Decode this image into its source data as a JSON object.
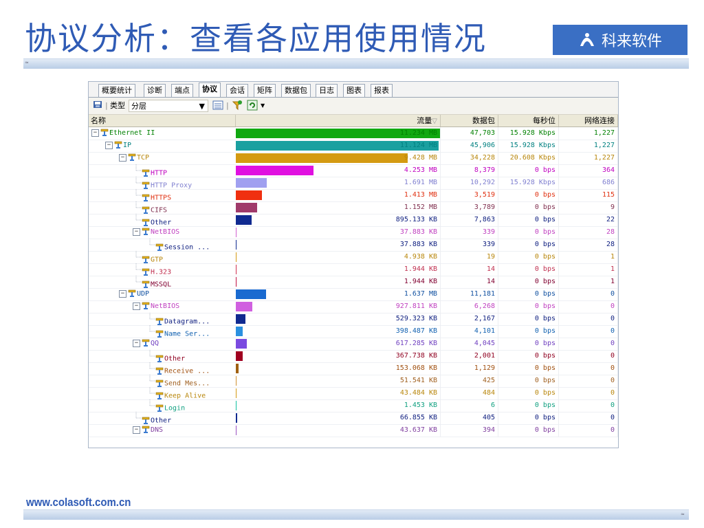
{
  "slide": {
    "title": "协议分析：查看各应用使用情况",
    "logo_text": "科来软件",
    "footer_url": "www.colasoft.com.cn",
    "corner_mark": "≈"
  },
  "tabs": [
    "概要统计",
    "诊断",
    "端点",
    "协议",
    "会话",
    "矩阵",
    "数据包",
    "日志",
    "图表",
    "报表"
  ],
  "active_tab": "协议",
  "toolbar": {
    "type_label": "类型",
    "type_value": "分层"
  },
  "columns": {
    "name": "名称",
    "traffic": "流量",
    "packets": "数据包",
    "bps": "每秒位",
    "connections": "网络连接"
  },
  "rows": [
    {
      "name": "Ethernet II",
      "level": 0,
      "expander": "−",
      "color": "#008000",
      "traffic": "11.234 MB",
      "packets": "47,703",
      "bps": "15.928 Kbps",
      "conn": "1,227",
      "fill": 1.0,
      "bar": "#11a811"
    },
    {
      "name": "IP",
      "level": 1,
      "expander": "−",
      "color": "#008080",
      "traffic": "11.124 MB",
      "packets": "45,906",
      "bps": "15.928 Kbps",
      "conn": "1,227",
      "fill": 0.99,
      "bar": "#1aa0a0"
    },
    {
      "name": "TCP",
      "level": 2,
      "expander": "−",
      "color": "#b8860b",
      "traffic": "9.428 MB",
      "packets": "34,228",
      "bps": "20.608 Kbps",
      "conn": "1,227",
      "fill": 0.84,
      "bar": "#d49a12"
    },
    {
      "name": "HTTP",
      "level": 3,
      "expander": "",
      "color": "#c000c0",
      "traffic": "4.253 MB",
      "packets": "8,379",
      "bps": "0 bps",
      "conn": "364",
      "fill": 0.38,
      "bar": "#e010e0"
    },
    {
      "name": "HTTP Proxy",
      "level": 3,
      "expander": "",
      "color": "#8080d0",
      "traffic": "1.691 MB",
      "packets": "10,292",
      "bps": "15.928 Kbps",
      "conn": "686",
      "fill": 0.15,
      "bar": "#a0a0f0"
    },
    {
      "name": "HTTPS",
      "level": 3,
      "expander": "",
      "color": "#e03010",
      "traffic": "1.413 MB",
      "packets": "3,519",
      "bps": "0 bps",
      "conn": "115",
      "fill": 0.126,
      "bar": "#f03010"
    },
    {
      "name": "CIFS",
      "level": 3,
      "expander": "",
      "color": "#803050",
      "traffic": "1.152 MB",
      "packets": "3,789",
      "bps": "0 bps",
      "conn": "9",
      "fill": 0.103,
      "bar": "#a03a6a"
    },
    {
      "name": "Other",
      "level": 3,
      "expander": "",
      "color": "#102080",
      "traffic": "895.133 KB",
      "packets": "7,863",
      "bps": "0 bps",
      "conn": "22",
      "fill": 0.078,
      "bar": "#102a90"
    },
    {
      "name": "NetBIOS",
      "level": 3,
      "expander": "−",
      "color": "#c040c0",
      "traffic": "37.883 KB",
      "packets": "339",
      "bps": "0 bps",
      "conn": "28",
      "fill": 0.004,
      "bar": "#d060d0"
    },
    {
      "name": "Session ...",
      "level": 4,
      "expander": "",
      "color": "#102080",
      "traffic": "37.883 KB",
      "packets": "339",
      "bps": "0 bps",
      "conn": "28",
      "fill": 0.004,
      "bar": "#102a90"
    },
    {
      "name": "GTP",
      "level": 3,
      "expander": "",
      "color": "#b8860b",
      "traffic": "4.938 KB",
      "packets": "19",
      "bps": "0 bps",
      "conn": "1",
      "fill": 0.002,
      "bar": "#d49a12"
    },
    {
      "name": "H.323",
      "level": 3,
      "expander": "",
      "color": "#c03050",
      "traffic": "1.944 KB",
      "packets": "14",
      "bps": "0 bps",
      "conn": "1",
      "fill": 0.002,
      "bar": "#d03050"
    },
    {
      "name": "MSSQL",
      "level": 3,
      "expander": "",
      "color": "#800030",
      "traffic": "1.944 KB",
      "packets": "14",
      "bps": "0 bps",
      "conn": "1",
      "fill": 0.002,
      "bar": "#c01040"
    },
    {
      "name": "UDP",
      "level": 2,
      "expander": "−",
      "color": "#1050a0",
      "traffic": "1.637 MB",
      "packets": "11,181",
      "bps": "0 bps",
      "conn": "0",
      "fill": 0.146,
      "bar": "#1a6ad0"
    },
    {
      "name": "NetBIOS",
      "level": 3,
      "expander": "−",
      "color": "#c040c0",
      "traffic": "927.811 KB",
      "packets": "6,268",
      "bps": "0 bps",
      "conn": "0",
      "fill": 0.081,
      "bar": "#d060e0"
    },
    {
      "name": "Datagram...",
      "level": 4,
      "expander": "",
      "color": "#102080",
      "traffic": "529.323 KB",
      "packets": "2,167",
      "bps": "0 bps",
      "conn": "0",
      "fill": 0.046,
      "bar": "#102a90"
    },
    {
      "name": "Name Ser...",
      "level": 4,
      "expander": "",
      "color": "#1060b0",
      "traffic": "398.487 KB",
      "packets": "4,101",
      "bps": "0 bps",
      "conn": "0",
      "fill": 0.035,
      "bar": "#2a90e0"
    },
    {
      "name": "QQ",
      "level": 3,
      "expander": "−",
      "color": "#7040c0",
      "traffic": "617.285 KB",
      "packets": "4,045",
      "bps": "0 bps",
      "conn": "0",
      "fill": 0.054,
      "bar": "#7a4ae0"
    },
    {
      "name": "Other",
      "level": 4,
      "expander": "",
      "color": "#900020",
      "traffic": "367.738 KB",
      "packets": "2,001",
      "bps": "0 bps",
      "conn": "0",
      "fill": 0.032,
      "bar": "#a00020"
    },
    {
      "name": "Receive ...",
      "level": 4,
      "expander": "",
      "color": "#a05010",
      "traffic": "153.068 KB",
      "packets": "1,129",
      "bps": "0 bps",
      "conn": "0",
      "fill": 0.013,
      "bar": "#a06010"
    },
    {
      "name": "Send Mes...",
      "level": 4,
      "expander": "",
      "color": "#a06020",
      "traffic": "51.541 KB",
      "packets": "425",
      "bps": "0 bps",
      "conn": "0",
      "fill": 0.005,
      "bar": "#d09030"
    },
    {
      "name": "Keep Alive",
      "level": 4,
      "expander": "",
      "color": "#b8860b",
      "traffic": "43.484 KB",
      "packets": "484",
      "bps": "0 bps",
      "conn": "0",
      "fill": 0.004,
      "bar": "#d49a12"
    },
    {
      "name": "Login",
      "level": 4,
      "expander": "",
      "color": "#10a080",
      "traffic": "1.453 KB",
      "packets": "6",
      "bps": "0 bps",
      "conn": "0",
      "fill": 0.001,
      "bar": "#10c0a0"
    },
    {
      "name": "Other",
      "level": 3,
      "expander": "",
      "color": "#102080",
      "traffic": "66.855 KB",
      "packets": "405",
      "bps": "0 bps",
      "conn": "0",
      "fill": 0.006,
      "bar": "#102a90"
    },
    {
      "name": "DNS",
      "level": 3,
      "expander": "−",
      "color": "#8040a0",
      "traffic": "43.637 KB",
      "packets": "394",
      "bps": "0 bps",
      "conn": "0",
      "fill": 0.004,
      "bar": "#9a50c0"
    }
  ]
}
